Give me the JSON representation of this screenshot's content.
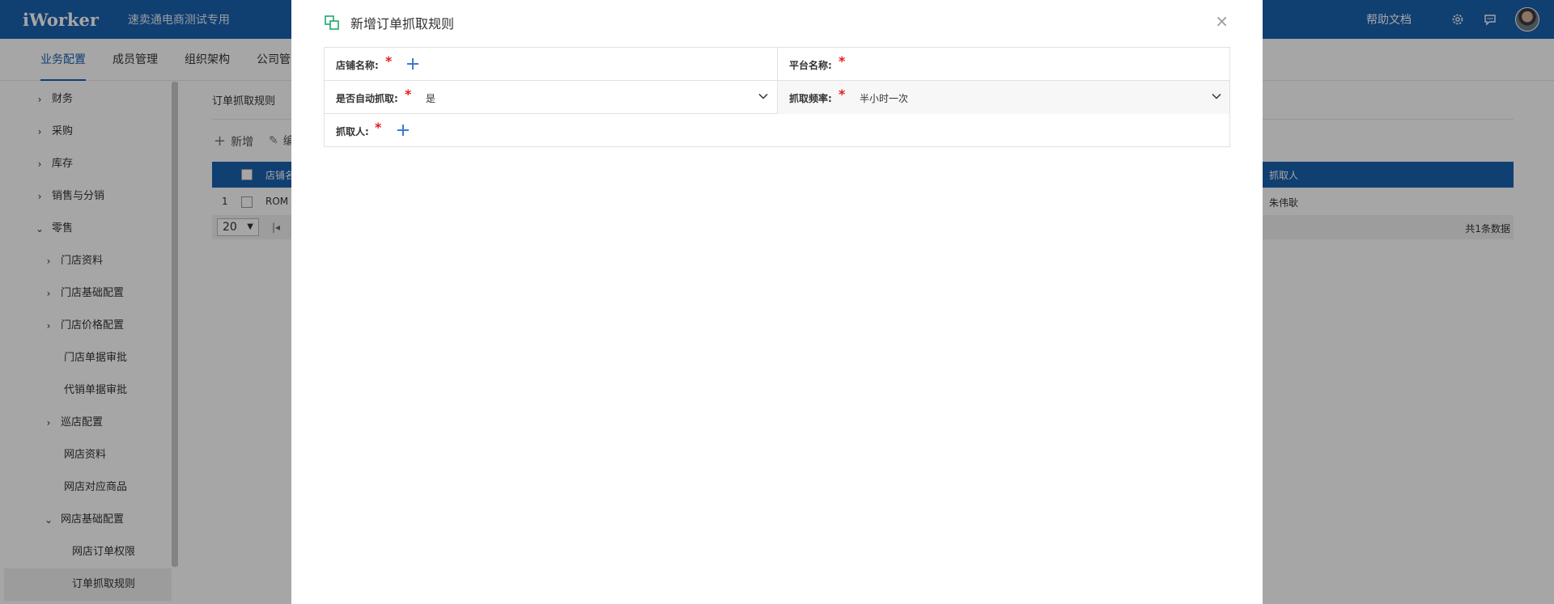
{
  "app": {
    "logo": "iWorker",
    "subtitle": "速卖通电商测试专用",
    "help": "帮助文档"
  },
  "tabs": [
    "业务配置",
    "成员管理",
    "组织架构",
    "公司管"
  ],
  "sidebar": {
    "items": [
      {
        "label": "财务",
        "chev": "›"
      },
      {
        "label": "采购",
        "chev": "›"
      },
      {
        "label": "库存",
        "chev": "›"
      },
      {
        "label": "销售与分销",
        "chev": "›"
      },
      {
        "label": "零售",
        "chev": "⌄"
      },
      {
        "label": "门店资料",
        "chev": "›"
      },
      {
        "label": "门店基础配置",
        "chev": "›"
      },
      {
        "label": "门店价格配置",
        "chev": "›"
      },
      {
        "label": "门店单据审批",
        "chev": ""
      },
      {
        "label": "代销单据审批",
        "chev": ""
      },
      {
        "label": "巡店配置",
        "chev": "›"
      },
      {
        "label": "网店资料",
        "chev": ""
      },
      {
        "label": "网店对应商品",
        "chev": ""
      },
      {
        "label": "网店基础配置",
        "chev": "⌄"
      },
      {
        "label": "网店订单权限",
        "chev": ""
      },
      {
        "label": "订单抓取规则",
        "chev": ""
      }
    ]
  },
  "main": {
    "breadcrumb": "订单抓取规则",
    "toolbar": {
      "add": "新增",
      "edit": "编"
    },
    "table": {
      "headers": {
        "shop": "店铺名",
        "fetcher": "抓取人"
      },
      "rows": [
        {
          "index": "1",
          "shop": "ROM",
          "fetcher": "朱伟耿"
        }
      ]
    },
    "pager": {
      "page_size": "20",
      "total": "共1条数据"
    }
  },
  "modal": {
    "title": "新增订单抓取规则",
    "close": "×",
    "fields": {
      "shop_name": {
        "label": "店铺名称:",
        "required": "*"
      },
      "platform_name": {
        "label": "平台名称:",
        "required": "*"
      },
      "auto_fetch": {
        "label": "是否自动抓取:",
        "required": "*",
        "value": "是"
      },
      "frequency": {
        "label": "抓取频率:",
        "required": "*",
        "value": "半小时一次"
      },
      "fetcher": {
        "label": "抓取人:",
        "required": "*"
      }
    }
  },
  "colors": {
    "brand": "#1a62b0",
    "required": "#e02020",
    "icon_green": "#20a86a",
    "plus_blue": "#3a7bd5"
  }
}
